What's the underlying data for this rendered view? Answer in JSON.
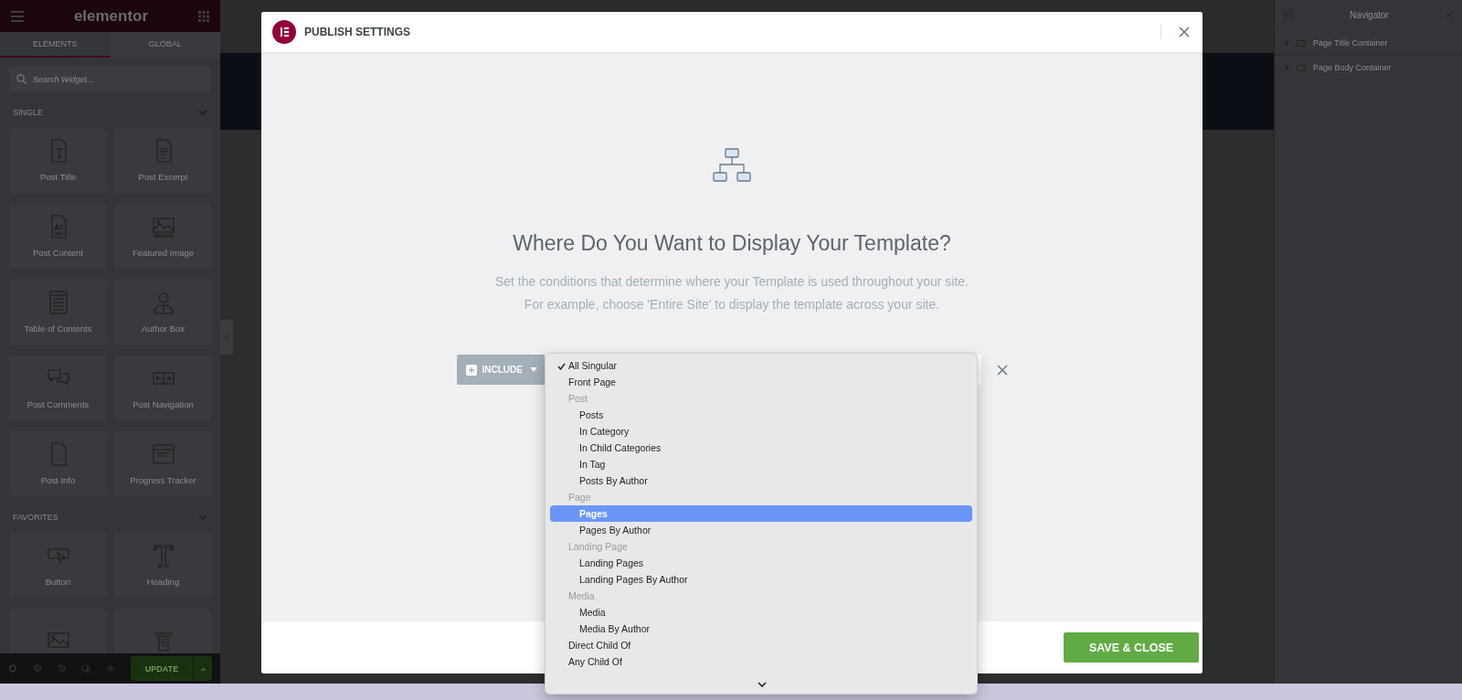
{
  "sidebar": {
    "logo": "elementor",
    "tabs": [
      {
        "label": "ELEMENTS",
        "selected": true
      },
      {
        "label": "GLOBAL",
        "selected": false
      }
    ],
    "search": {
      "placeholder": "Search Widget..."
    },
    "sections": [
      {
        "title": "SINGLE",
        "expanded": true,
        "widgets": [
          {
            "label": "Post Title",
            "kind": "title"
          },
          {
            "label": "Post Excerpt",
            "kind": "excerpt"
          },
          {
            "label": "Post Content",
            "kind": "content"
          },
          {
            "label": "Featured Image",
            "kind": "image"
          },
          {
            "label": "Table of Contents",
            "kind": "toc"
          },
          {
            "label": "Author Box",
            "kind": "person"
          },
          {
            "label": "Post Comments",
            "kind": "comments"
          },
          {
            "label": "Post Navigation",
            "kind": "navigation"
          },
          {
            "label": "Post Info",
            "kind": "info"
          },
          {
            "label": "Progress Tracker",
            "kind": "browser"
          }
        ]
      },
      {
        "title": "FAVORITES",
        "expanded": true,
        "widgets": [
          {
            "label": "Button",
            "kind": "button"
          },
          {
            "label": "Heading",
            "kind": "heading"
          },
          {
            "kind": "picture"
          },
          {
            "kind": "editor"
          }
        ]
      }
    ],
    "update": "UPDATE"
  },
  "navigator": {
    "title": "Navigator",
    "items": [
      {
        "label": "Page Title Container"
      },
      {
        "label": "Page Body Container"
      }
    ]
  },
  "modal": {
    "title": "PUBLISH SETTINGS",
    "heading": "Where Do You Want to Display Your Template?",
    "description": [
      "Set the conditions that determine where your Template is used throughout your site.",
      "For example, choose 'Entire Site' to display the template across your site."
    ],
    "condition": {
      "type": "INCLUDE"
    },
    "options": [
      {
        "kind": "option",
        "label": "All Singular",
        "checked": true,
        "selected": false
      },
      {
        "kind": "option",
        "label": "Front Page",
        "checked": false,
        "selected": false
      },
      {
        "kind": "group",
        "label": "Post",
        "children": [
          {
            "kind": "option",
            "label": "Posts",
            "checked": false,
            "selected": false
          },
          {
            "kind": "option",
            "label": "In Category",
            "checked": false,
            "selected": false
          },
          {
            "kind": "option",
            "label": "In Child Categories",
            "checked": false,
            "selected": false
          },
          {
            "kind": "option",
            "label": "In Tag",
            "checked": false,
            "selected": false
          },
          {
            "kind": "option",
            "label": "Posts By Author",
            "checked": false,
            "selected": false
          }
        ]
      },
      {
        "kind": "group",
        "label": "Page",
        "children": [
          {
            "kind": "option",
            "label": "Pages",
            "checked": false,
            "selected": true
          },
          {
            "kind": "option",
            "label": "Pages By Author",
            "checked": false,
            "selected": false
          }
        ]
      },
      {
        "kind": "group",
        "label": "Landing Page",
        "children": [
          {
            "kind": "option",
            "label": "Landing Pages",
            "checked": false,
            "selected": false
          },
          {
            "kind": "option",
            "label": "Landing Pages By Author",
            "checked": false,
            "selected": false
          }
        ]
      },
      {
        "kind": "group",
        "label": "Media",
        "children": [
          {
            "kind": "option",
            "label": "Media",
            "checked": false,
            "selected": false
          },
          {
            "kind": "option",
            "label": "Media By Author",
            "checked": false,
            "selected": false
          }
        ]
      },
      {
        "kind": "option",
        "label": "Direct Child Of",
        "checked": false,
        "selected": false
      },
      {
        "kind": "option",
        "label": "Any Child Of",
        "checked": false,
        "selected": false
      }
    ],
    "save": "SAVE & CLOSE"
  }
}
